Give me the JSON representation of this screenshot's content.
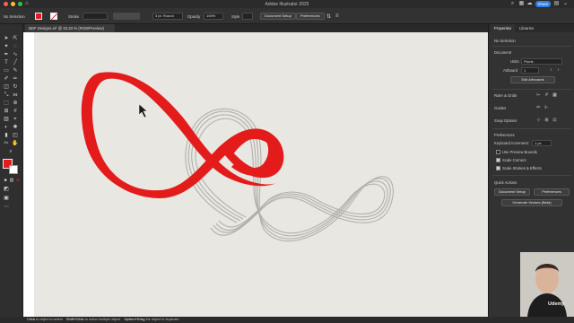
{
  "window": {
    "title": "Adobe Illustrator 2025"
  },
  "header": {
    "share_label": "Share"
  },
  "control_bar": {
    "selection_label": "No Selection",
    "stroke_label": "Stroke",
    "stroke_value": "",
    "brush_value": "3 pt. Round",
    "opacity_label": "Opacity",
    "opacity_value": "100%",
    "style_label": "Style",
    "document_setup_label": "Document Setup",
    "preferences_label": "Preferences",
    "fill_color": "#e31b1b"
  },
  "document_tab": {
    "label": "BDF Designs.ai* @ 33.33 % (RGB/Preview)"
  },
  "panel": {
    "tabs": [
      "Properties",
      "Libraries"
    ],
    "selection": "No Selection",
    "document_heading": "Document",
    "units_label": "Units",
    "units_value": "Pixels",
    "artboard_label": "Artboard",
    "artboard_value": "1",
    "edit_artboards_label": "Edit Artboards",
    "rulers_label": "Ruler & Grids",
    "guides_label": "Guides",
    "snap_label": "Snap Options",
    "preferences_heading": "Preferences",
    "keyboard_increment_label": "Keyboard Increment:",
    "keyboard_increment_value": "1 px",
    "use_preview_bounds": "Use Preview Bounds",
    "scale_corners": "Scale Corners",
    "scale_strokes": "Scale Strokes & Effects",
    "quick_actions_heading": "Quick Actions",
    "document_setup_label": "Document Setup",
    "preferences_button_label": "Preferences",
    "generate_vectors_label": "Generate Vectors (Beta)"
  },
  "status": {
    "hint_1": "Click",
    "hint_1_text": "to object to select",
    "hint_2": "Shift+Click",
    "hint_2_text": "to select multiple object",
    "hint_3": "Option+Drag",
    "hint_3_text": "the object to duplicate"
  },
  "watermark": "Udemy",
  "colors": {
    "accent": "#2f7de1",
    "shape_red": "#e31b1b",
    "paper": "#e9e7e1"
  },
  "icons": [
    "home-icon",
    "selection-tool-icon",
    "pen-tool-icon",
    "type-tool-icon",
    "cursor-icon"
  ]
}
